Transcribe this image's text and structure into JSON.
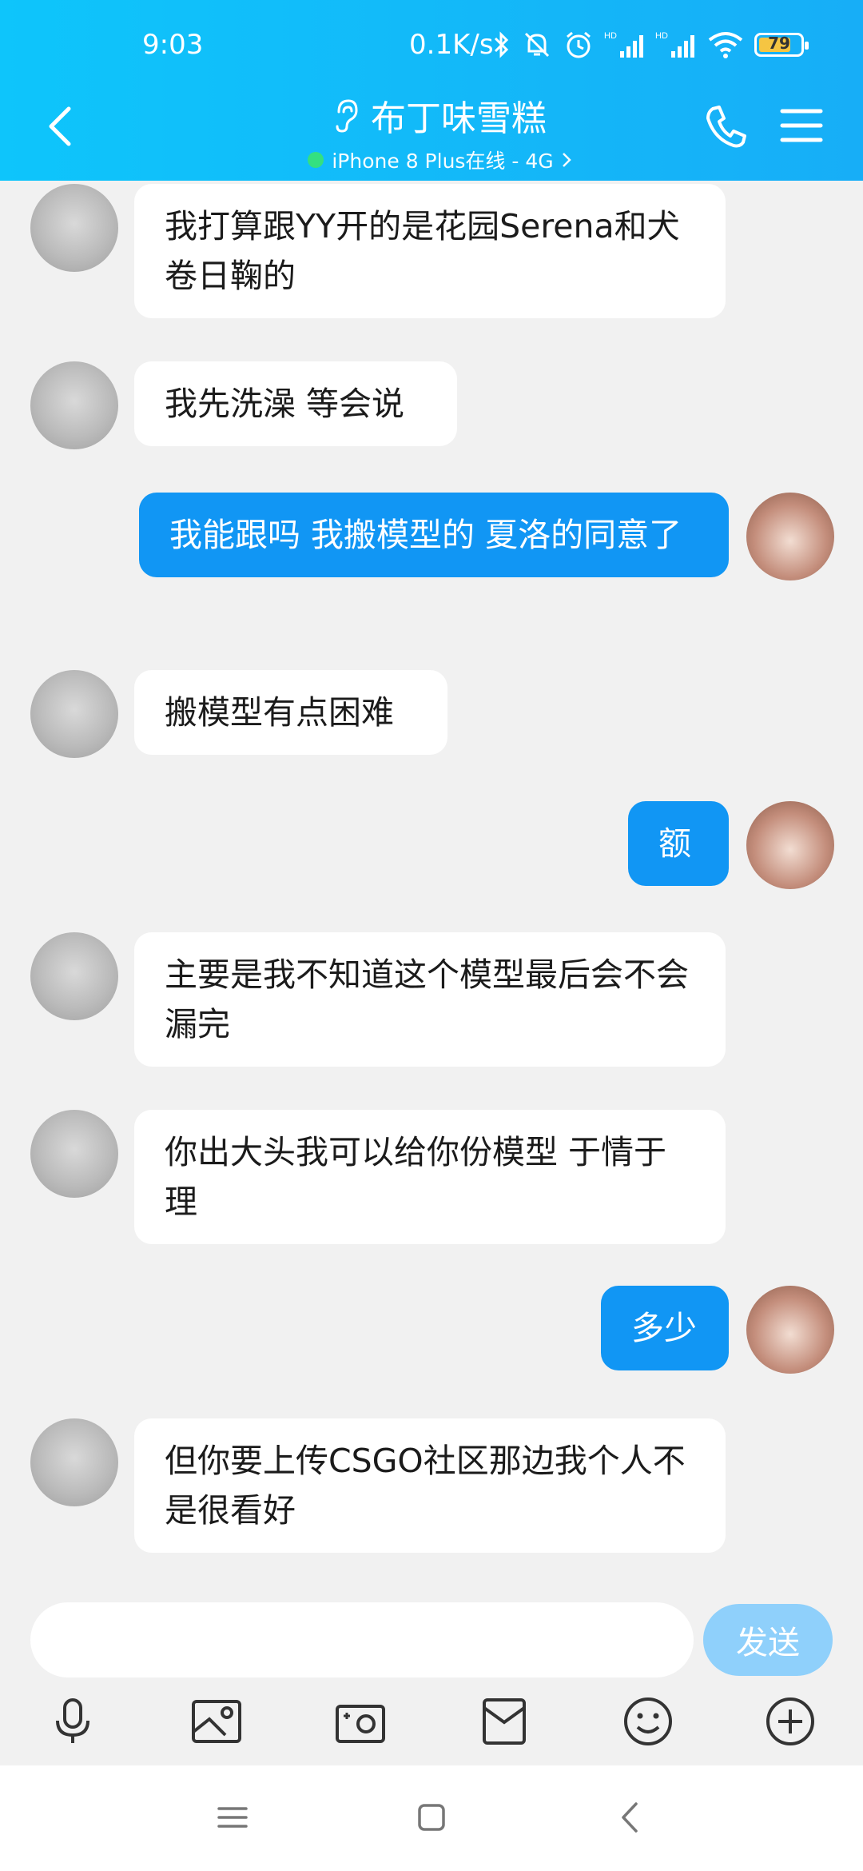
{
  "status_bar": {
    "time": "9:03",
    "speed": "0.1K/s",
    "battery": "79"
  },
  "header": {
    "title": "布丁味雪糕",
    "subtitle": "iPhone 8 Plus在线 - 4G",
    "online_color": "#36e27d"
  },
  "messages": [
    {
      "side": "left",
      "text": "我打算跟YY开的是花园Serena和犬卷日鞠的"
    },
    {
      "side": "left",
      "text": "我先洗澡 等会说"
    },
    {
      "side": "right",
      "text": "我能跟吗 我搬模型的 夏洛的同意了"
    },
    {
      "side": "left",
      "text": "搬模型有点困难"
    },
    {
      "side": "right",
      "text": "额"
    },
    {
      "side": "left",
      "text": "主要是我不知道这个模型最后会不会漏完"
    },
    {
      "side": "left",
      "text": "你出大头我可以给你份模型 于情于理"
    },
    {
      "side": "right",
      "text": "多少"
    },
    {
      "side": "left",
      "text": "但你要上传CSGO社区那边我个人不是很看好"
    }
  ],
  "composer": {
    "send_label": "发送",
    "input_value": ""
  },
  "toolbar_icons": [
    "microphone-icon",
    "image-icon",
    "camera-icon",
    "red-packet-icon",
    "emoji-icon",
    "plus-icon"
  ],
  "nav_icons": [
    "menu-icon",
    "home-icon",
    "back-icon"
  ],
  "colors": {
    "header": "#17aef7",
    "self_bubble": "#1196f4",
    "send_button": "#8fd0fb"
  }
}
